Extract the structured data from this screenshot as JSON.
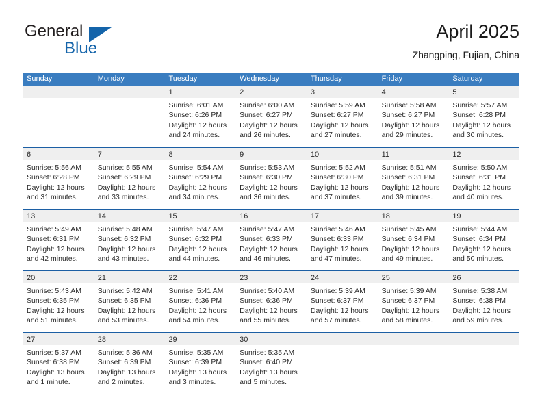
{
  "brand": {
    "name_part1": "General",
    "name_part2": "Blue",
    "triangle_color": "#1464aa",
    "text_color": "#231f20"
  },
  "header": {
    "title": "April 2025",
    "subtitle": "Zhangping, Fujian, China"
  },
  "theme": {
    "header_bg": "#3a7dc0",
    "header_text": "#ffffff",
    "row_divider": "#1c5fa4",
    "day_band_bg": "#efefef",
    "cell_bg": "#ffffff",
    "text": "#2b2b2b"
  },
  "weekdays": [
    "Sunday",
    "Monday",
    "Tuesday",
    "Wednesday",
    "Thursday",
    "Friday",
    "Saturday"
  ],
  "weeks": [
    [
      {
        "day": "",
        "lines": []
      },
      {
        "day": "",
        "lines": []
      },
      {
        "day": "1",
        "lines": [
          "Sunrise: 6:01 AM",
          "Sunset: 6:26 PM",
          "Daylight: 12 hours",
          "and 24 minutes."
        ]
      },
      {
        "day": "2",
        "lines": [
          "Sunrise: 6:00 AM",
          "Sunset: 6:27 PM",
          "Daylight: 12 hours",
          "and 26 minutes."
        ]
      },
      {
        "day": "3",
        "lines": [
          "Sunrise: 5:59 AM",
          "Sunset: 6:27 PM",
          "Daylight: 12 hours",
          "and 27 minutes."
        ]
      },
      {
        "day": "4",
        "lines": [
          "Sunrise: 5:58 AM",
          "Sunset: 6:27 PM",
          "Daylight: 12 hours",
          "and 29 minutes."
        ]
      },
      {
        "day": "5",
        "lines": [
          "Sunrise: 5:57 AM",
          "Sunset: 6:28 PM",
          "Daylight: 12 hours",
          "and 30 minutes."
        ]
      }
    ],
    [
      {
        "day": "6",
        "lines": [
          "Sunrise: 5:56 AM",
          "Sunset: 6:28 PM",
          "Daylight: 12 hours",
          "and 31 minutes."
        ]
      },
      {
        "day": "7",
        "lines": [
          "Sunrise: 5:55 AM",
          "Sunset: 6:29 PM",
          "Daylight: 12 hours",
          "and 33 minutes."
        ]
      },
      {
        "day": "8",
        "lines": [
          "Sunrise: 5:54 AM",
          "Sunset: 6:29 PM",
          "Daylight: 12 hours",
          "and 34 minutes."
        ]
      },
      {
        "day": "9",
        "lines": [
          "Sunrise: 5:53 AM",
          "Sunset: 6:30 PM",
          "Daylight: 12 hours",
          "and 36 minutes."
        ]
      },
      {
        "day": "10",
        "lines": [
          "Sunrise: 5:52 AM",
          "Sunset: 6:30 PM",
          "Daylight: 12 hours",
          "and 37 minutes."
        ]
      },
      {
        "day": "11",
        "lines": [
          "Sunrise: 5:51 AM",
          "Sunset: 6:31 PM",
          "Daylight: 12 hours",
          "and 39 minutes."
        ]
      },
      {
        "day": "12",
        "lines": [
          "Sunrise: 5:50 AM",
          "Sunset: 6:31 PM",
          "Daylight: 12 hours",
          "and 40 minutes."
        ]
      }
    ],
    [
      {
        "day": "13",
        "lines": [
          "Sunrise: 5:49 AM",
          "Sunset: 6:31 PM",
          "Daylight: 12 hours",
          "and 42 minutes."
        ]
      },
      {
        "day": "14",
        "lines": [
          "Sunrise: 5:48 AM",
          "Sunset: 6:32 PM",
          "Daylight: 12 hours",
          "and 43 minutes."
        ]
      },
      {
        "day": "15",
        "lines": [
          "Sunrise: 5:47 AM",
          "Sunset: 6:32 PM",
          "Daylight: 12 hours",
          "and 44 minutes."
        ]
      },
      {
        "day": "16",
        "lines": [
          "Sunrise: 5:47 AM",
          "Sunset: 6:33 PM",
          "Daylight: 12 hours",
          "and 46 minutes."
        ]
      },
      {
        "day": "17",
        "lines": [
          "Sunrise: 5:46 AM",
          "Sunset: 6:33 PM",
          "Daylight: 12 hours",
          "and 47 minutes."
        ]
      },
      {
        "day": "18",
        "lines": [
          "Sunrise: 5:45 AM",
          "Sunset: 6:34 PM",
          "Daylight: 12 hours",
          "and 49 minutes."
        ]
      },
      {
        "day": "19",
        "lines": [
          "Sunrise: 5:44 AM",
          "Sunset: 6:34 PM",
          "Daylight: 12 hours",
          "and 50 minutes."
        ]
      }
    ],
    [
      {
        "day": "20",
        "lines": [
          "Sunrise: 5:43 AM",
          "Sunset: 6:35 PM",
          "Daylight: 12 hours",
          "and 51 minutes."
        ]
      },
      {
        "day": "21",
        "lines": [
          "Sunrise: 5:42 AM",
          "Sunset: 6:35 PM",
          "Daylight: 12 hours",
          "and 53 minutes."
        ]
      },
      {
        "day": "22",
        "lines": [
          "Sunrise: 5:41 AM",
          "Sunset: 6:36 PM",
          "Daylight: 12 hours",
          "and 54 minutes."
        ]
      },
      {
        "day": "23",
        "lines": [
          "Sunrise: 5:40 AM",
          "Sunset: 6:36 PM",
          "Daylight: 12 hours",
          "and 55 minutes."
        ]
      },
      {
        "day": "24",
        "lines": [
          "Sunrise: 5:39 AM",
          "Sunset: 6:37 PM",
          "Daylight: 12 hours",
          "and 57 minutes."
        ]
      },
      {
        "day": "25",
        "lines": [
          "Sunrise: 5:39 AM",
          "Sunset: 6:37 PM",
          "Daylight: 12 hours",
          "and 58 minutes."
        ]
      },
      {
        "day": "26",
        "lines": [
          "Sunrise: 5:38 AM",
          "Sunset: 6:38 PM",
          "Daylight: 12 hours",
          "and 59 minutes."
        ]
      }
    ],
    [
      {
        "day": "27",
        "lines": [
          "Sunrise: 5:37 AM",
          "Sunset: 6:38 PM",
          "Daylight: 13 hours",
          "and 1 minute."
        ]
      },
      {
        "day": "28",
        "lines": [
          "Sunrise: 5:36 AM",
          "Sunset: 6:39 PM",
          "Daylight: 13 hours",
          "and 2 minutes."
        ]
      },
      {
        "day": "29",
        "lines": [
          "Sunrise: 5:35 AM",
          "Sunset: 6:39 PM",
          "Daylight: 13 hours",
          "and 3 minutes."
        ]
      },
      {
        "day": "30",
        "lines": [
          "Sunrise: 5:35 AM",
          "Sunset: 6:40 PM",
          "Daylight: 13 hours",
          "and 5 minutes."
        ]
      },
      {
        "day": "",
        "lines": []
      },
      {
        "day": "",
        "lines": []
      },
      {
        "day": "",
        "lines": []
      }
    ]
  ]
}
